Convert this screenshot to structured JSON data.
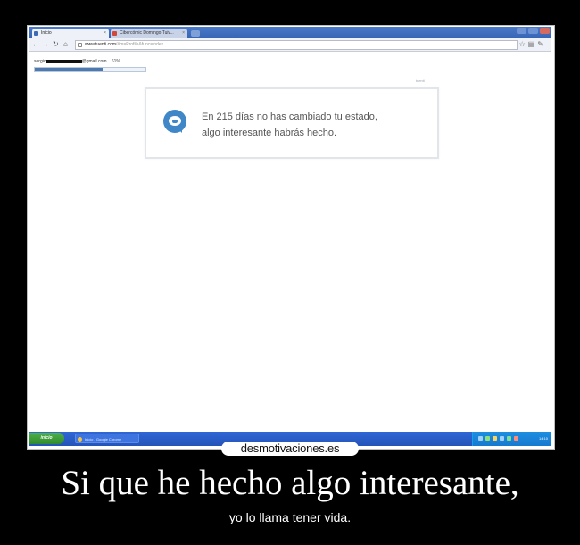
{
  "browser": {
    "tabs": [
      {
        "label": "Inicio",
        "state": "active"
      },
      {
        "label": "Cibercómic Domingo Tuiv...",
        "state": "inactive"
      }
    ],
    "address": {
      "domain": "www.tuenti.com",
      "path": "/#m=Profile&func=index"
    }
  },
  "page": {
    "account_label": "sergio",
    "account_suffix": "@gmail.com",
    "account_progress_label": "61%",
    "account_progress": 0.61,
    "brand_tag": "tuenti",
    "notice_line1": "En 215 días no has cambiado tu estado,",
    "notice_line2": "algo interesante habrás hecho."
  },
  "taskbar": {
    "start_label": "inicio",
    "task_label": "Inicio - Google Chrome",
    "clock": "14:10"
  },
  "poster": {
    "watermark": "desmotivaciones.es",
    "title": "Si que he hecho algo interesante,",
    "subtitle": "yo lo llama tener vida."
  },
  "colors": {
    "background": "#000000",
    "accent_blue": "#3f87c7",
    "taskbar_blue": "#2454b8"
  }
}
